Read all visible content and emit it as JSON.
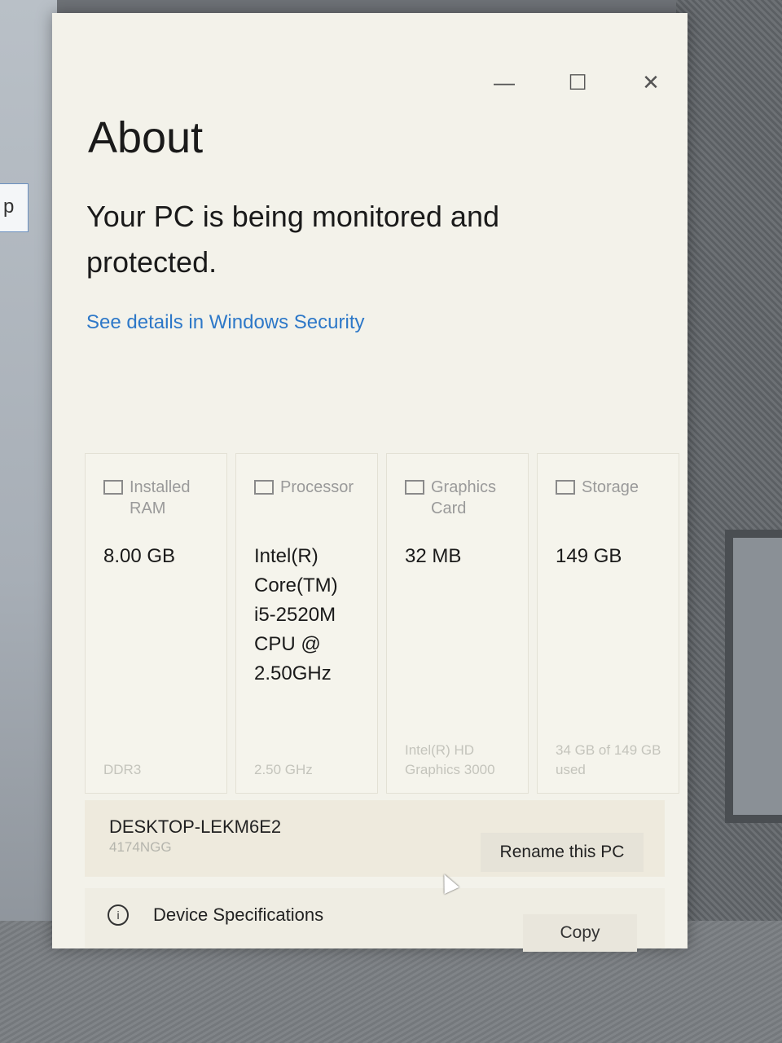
{
  "window": {
    "title": "About",
    "controls": {
      "minimize": "—",
      "maximize": "☐",
      "close": "✕"
    }
  },
  "security": {
    "message": "Your PC is being monitored and protected.",
    "link": "See details in Windows Security"
  },
  "specs": [
    {
      "label": "Installed RAM",
      "value": "8.00 GB",
      "sub": "DDR3",
      "icon": "memory-icon"
    },
    {
      "label": "Processor",
      "value": "Intel(R) Core(TM) i5-2520M CPU @ 2.50GHz",
      "sub": "2.50 GHz",
      "icon": "processor-icon"
    },
    {
      "label": "Graphics Card",
      "value": "32 MB",
      "sub": "Intel(R) HD Graphics 3000",
      "icon": "graphics-card-icon"
    },
    {
      "label": "Storage",
      "value": "149 GB",
      "sub": "34 GB of 149 GB used",
      "icon": "storage-icon"
    }
  ],
  "pc": {
    "name": "DESKTOP-LEKM6E2",
    "model": "4174NGG",
    "rename_label": "Rename this PC"
  },
  "device_specs": {
    "title": "Device Specifications",
    "copy_label": "Copy"
  },
  "background": {
    "search_glyph": "p"
  }
}
